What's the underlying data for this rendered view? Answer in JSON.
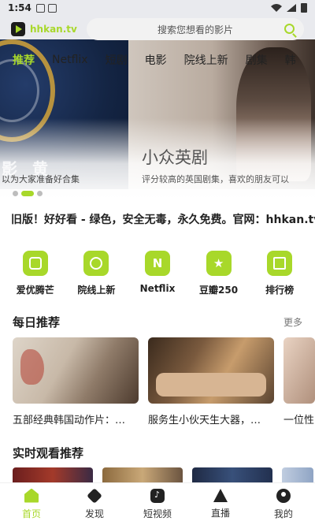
{
  "status": {
    "time": "1:54"
  },
  "header": {
    "logo_text": "hhkan.tv",
    "search_placeholder": "搜索您想看的影片"
  },
  "tabs": [
    "推荐",
    "Netflix",
    "短剧",
    "电影",
    "院线上新",
    "剧集",
    "韩"
  ],
  "banner": {
    "left_title": "影 黄",
    "left_subtitle": "以为大家准备好合集",
    "right_title": "小众英剧",
    "right_subtitle": "评分较高的英国剧集，喜欢的朋友可以"
  },
  "notice": "旧版！好好看 - 绿色，安全无毒，永久免费。官网：hhkan.tv",
  "quick_links": [
    {
      "label": "爱优腾芒",
      "icon": "tv-icon",
      "glyph": ""
    },
    {
      "label": "院线上新",
      "icon": "cinema-icon",
      "glyph": ""
    },
    {
      "label": "Netflix",
      "icon": "netflix-icon",
      "glyph": "N"
    },
    {
      "label": "豆瓣250",
      "icon": "star-icon",
      "glyph": "★"
    },
    {
      "label": "排行榜",
      "icon": "ranking-icon",
      "glyph": ""
    }
  ],
  "sections": {
    "daily": {
      "title": "每日推荐",
      "more": "更多"
    },
    "realtime": {
      "title": "实时观看推荐"
    }
  },
  "daily_cards": [
    {
      "title": "五部经典韩国动作片：…"
    },
    {
      "title": "服务生小伙天生大器，…"
    },
    {
      "title": "一位性"
    }
  ],
  "bottom_nav": [
    {
      "label": "首页",
      "icon": "home-icon",
      "active": true
    },
    {
      "label": "发现",
      "icon": "discover-icon",
      "active": false
    },
    {
      "label": "短视频",
      "icon": "short-video-icon",
      "active": false
    },
    {
      "label": "直播",
      "icon": "live-icon",
      "active": false
    },
    {
      "label": "我的",
      "icon": "profile-icon",
      "active": false
    }
  ],
  "colors": {
    "accent": "#a8d82a",
    "text": "#222222"
  }
}
